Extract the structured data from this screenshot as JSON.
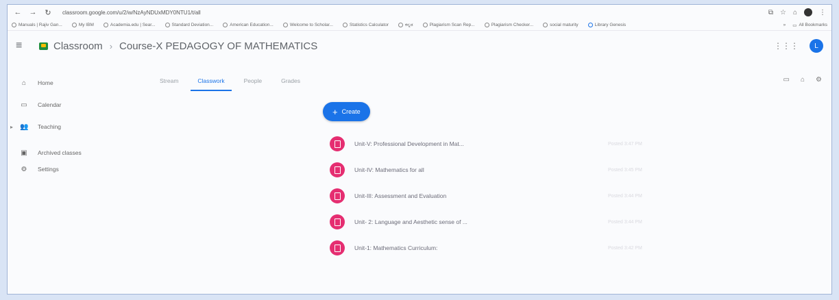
{
  "browser": {
    "url": "classroom.google.com/u/2/w/NzAyNDUxMDY0NTU1/t/all",
    "bookmarks": [
      "Manuals | Rajiv Gan...",
      "My IBM",
      "Academia.edu | Sear...",
      "Standard Deviation...",
      "American Education...",
      "Welcome to Scholar...",
      "Statistics Calculator",
      "ಕನ್ನಡ",
      "Plagiarism Scan Rep...",
      "Plagiarism Checker...",
      "social maturity",
      "Library Genesis"
    ],
    "all_bookmarks": "All Bookmarks"
  },
  "app": {
    "name": "Classroom",
    "course": "Course-X PEDAGOGY OF MATHEMATICS",
    "avatar_letter": "L"
  },
  "sidebar": {
    "items": [
      {
        "icon": "home-icon",
        "label": "Home"
      },
      {
        "icon": "calendar-icon",
        "label": "Calendar"
      },
      {
        "icon": "teaching-icon",
        "label": "Teaching"
      },
      {
        "icon": "archive-icon",
        "label": "Archived classes"
      },
      {
        "icon": "settings-icon",
        "label": "Settings"
      }
    ]
  },
  "tabs": [
    "Stream",
    "Classwork",
    "People",
    "Grades"
  ],
  "create_label": "Create",
  "topics": [
    {
      "title": "Unit-V: Professional Development in Mat...",
      "time": "Posted 3:47 PM"
    },
    {
      "title": "Unit-IV: Mathematics for all",
      "time": "Posted 3:45 PM"
    },
    {
      "title": "Unit-III: Assessment and Evaluation",
      "time": "Posted 3:44 PM"
    },
    {
      "title": "Unit- 2: Language and Aesthetic sense of ...",
      "time": "Posted 3:44 PM"
    },
    {
      "title": "Unit-1: Mathematics Curriculum:",
      "time": "Posted 3:42 PM"
    }
  ],
  "colors": {
    "accent": "#1a73e8",
    "topic_icon": "#e52e71"
  }
}
